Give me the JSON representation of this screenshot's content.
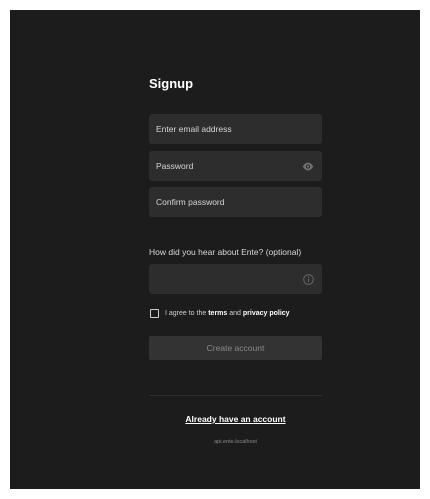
{
  "form": {
    "title": "Signup",
    "email": {
      "placeholder": "Enter email address",
      "value": ""
    },
    "password": {
      "placeholder": "Password",
      "value": ""
    },
    "confirm_password": {
      "placeholder": "Confirm password",
      "value": ""
    },
    "referral": {
      "label": "How did you hear about Ente? (optional)",
      "value": ""
    },
    "terms": {
      "prefix": "I agree to the",
      "terms_link": "terms",
      "and": "and",
      "privacy_link": "privacy policy",
      "checked": false
    },
    "submit_label": "Create account"
  },
  "footer": {
    "login_link": "Already have an account",
    "endpoint": "api.ente.localhost"
  },
  "icons": {
    "password_toggle": "eye-icon",
    "referral_info": "info-icon"
  },
  "colors": {
    "background": "#1c1c1c",
    "field": "#2d2d2d",
    "button_disabled": "#333333",
    "text": "#ffffff"
  }
}
